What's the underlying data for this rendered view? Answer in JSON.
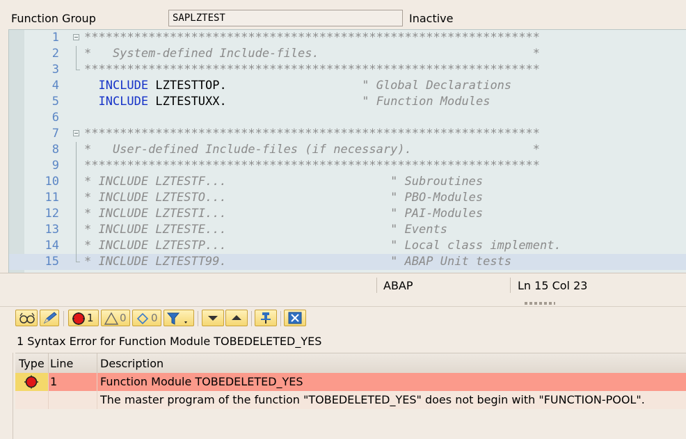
{
  "header": {
    "object_type_label": "Function Group",
    "object_name": "SAPLZTEST",
    "status": "Inactive"
  },
  "editor": {
    "lines": [
      {
        "num": "1",
        "text": "****************************************************************",
        "kind": "comment"
      },
      {
        "num": "2",
        "text": "*   System-defined Include-files.                              *",
        "kind": "comment"
      },
      {
        "num": "3",
        "text": "****************************************************************",
        "kind": "comment"
      },
      {
        "num": "4",
        "kw": "INCLUDE",
        "name": "LZTESTTOP.",
        "comment": "\" Global Declarations",
        "kind": "include"
      },
      {
        "num": "5",
        "kw": "INCLUDE",
        "name": "LZTESTUXX.",
        "comment": "\" Function Modules",
        "kind": "include"
      },
      {
        "num": "6",
        "text": "",
        "kind": "blank"
      },
      {
        "num": "7",
        "text": "****************************************************************",
        "kind": "comment"
      },
      {
        "num": "8",
        "text": "*   User-defined Include-files (if necessary).                 *",
        "kind": "comment"
      },
      {
        "num": "9",
        "text": "****************************************************************",
        "kind": "comment"
      },
      {
        "num": "10",
        "text": "* INCLUDE LZTESTF...                       \" Subroutines",
        "kind": "comment"
      },
      {
        "num": "11",
        "text": "* INCLUDE LZTESTO...                       \" PBO-Modules",
        "kind": "comment"
      },
      {
        "num": "12",
        "text": "* INCLUDE LZTESTI...                       \" PAI-Modules",
        "kind": "comment"
      },
      {
        "num": "13",
        "text": "* INCLUDE LZTESTE...                       \" Events",
        "kind": "comment"
      },
      {
        "num": "14",
        "text": "* INCLUDE LZTESTP...                       \" Local class implement.",
        "kind": "comment"
      },
      {
        "num": "15",
        "text": "* INCLUDE LZTESTT99.                       \" ABAP Unit tests",
        "kind": "comment"
      }
    ]
  },
  "status_bar": {
    "language": "ABAP",
    "position": "Ln  15 Col  23"
  },
  "toolbar": {
    "error_count": "1",
    "warning_count": "0",
    "info_count": "0"
  },
  "messages": {
    "title": "1 Syntax Error for Function Module TOBEDELETED_YES",
    "columns": {
      "type": "Type",
      "line": "Line",
      "description": "Description"
    },
    "error": {
      "line": "1",
      "description": "Function Module TOBEDELETED_YES"
    },
    "detail": "The master program of the function \"TOBEDELETED_YES\" does not begin with \"FUNCTION-POOL\"."
  },
  "colors": {
    "error_row": "#fb9a8b",
    "keyword": "#1532c8",
    "comment": "#8b8b8b",
    "line_number": "#5b86c5"
  }
}
